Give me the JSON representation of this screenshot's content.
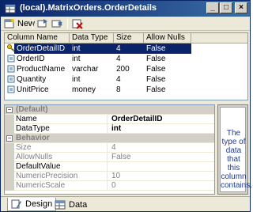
{
  "window": {
    "title": "(local).MatrixOrders.OrderDetails",
    "controls": {
      "minimize": "_",
      "maximize": "□",
      "close": "×"
    }
  },
  "toolbar": {
    "new_label": "New",
    "icons": [
      "new-table-icon",
      "insert-column-icon",
      "delete-column-icon",
      "delete-red-icon"
    ]
  },
  "grid": {
    "headers": [
      "Column Name",
      "Data Type",
      "Size",
      "Allow Nulls"
    ],
    "rows": [
      {
        "name": "OrderDetailID",
        "type": "int",
        "size": "4",
        "nulls": "False",
        "selected": true,
        "key": true
      },
      {
        "name": "OrderID",
        "type": "int",
        "size": "4",
        "nulls": "False"
      },
      {
        "name": "ProductName",
        "type": "varchar",
        "size": "200",
        "nulls": "False"
      },
      {
        "name": "Quantity",
        "type": "int",
        "size": "4",
        "nulls": "False"
      },
      {
        "name": "UnitPrice",
        "type": "money",
        "size": "8",
        "nulls": "False"
      }
    ]
  },
  "properties": {
    "rows": [
      {
        "kind": "cat",
        "name": "(Default)",
        "value": ""
      },
      {
        "kind": "prop",
        "name": "Name",
        "value": "OrderDetailID"
      },
      {
        "kind": "prop",
        "name": "DataType",
        "value": "int"
      },
      {
        "kind": "cat",
        "name": "Behavior",
        "value": ""
      },
      {
        "kind": "dim",
        "name": "Size",
        "value": "4"
      },
      {
        "kind": "dim",
        "name": "AllowNulls",
        "value": "False"
      },
      {
        "kind": "prop",
        "name": "DefaultValue",
        "value": ""
      },
      {
        "kind": "dim",
        "name": "NumericPrecision",
        "value": "10"
      },
      {
        "kind": "dim",
        "name": "NumericScale",
        "value": "0"
      }
    ]
  },
  "help": {
    "text": "The type of data that this column contains."
  },
  "bottom_tabs": [
    {
      "label": "Design",
      "active": true
    },
    {
      "label": "Data",
      "active": false
    }
  ],
  "colors": {
    "selection": "#0a246a",
    "help_text": "#1f3a93"
  }
}
